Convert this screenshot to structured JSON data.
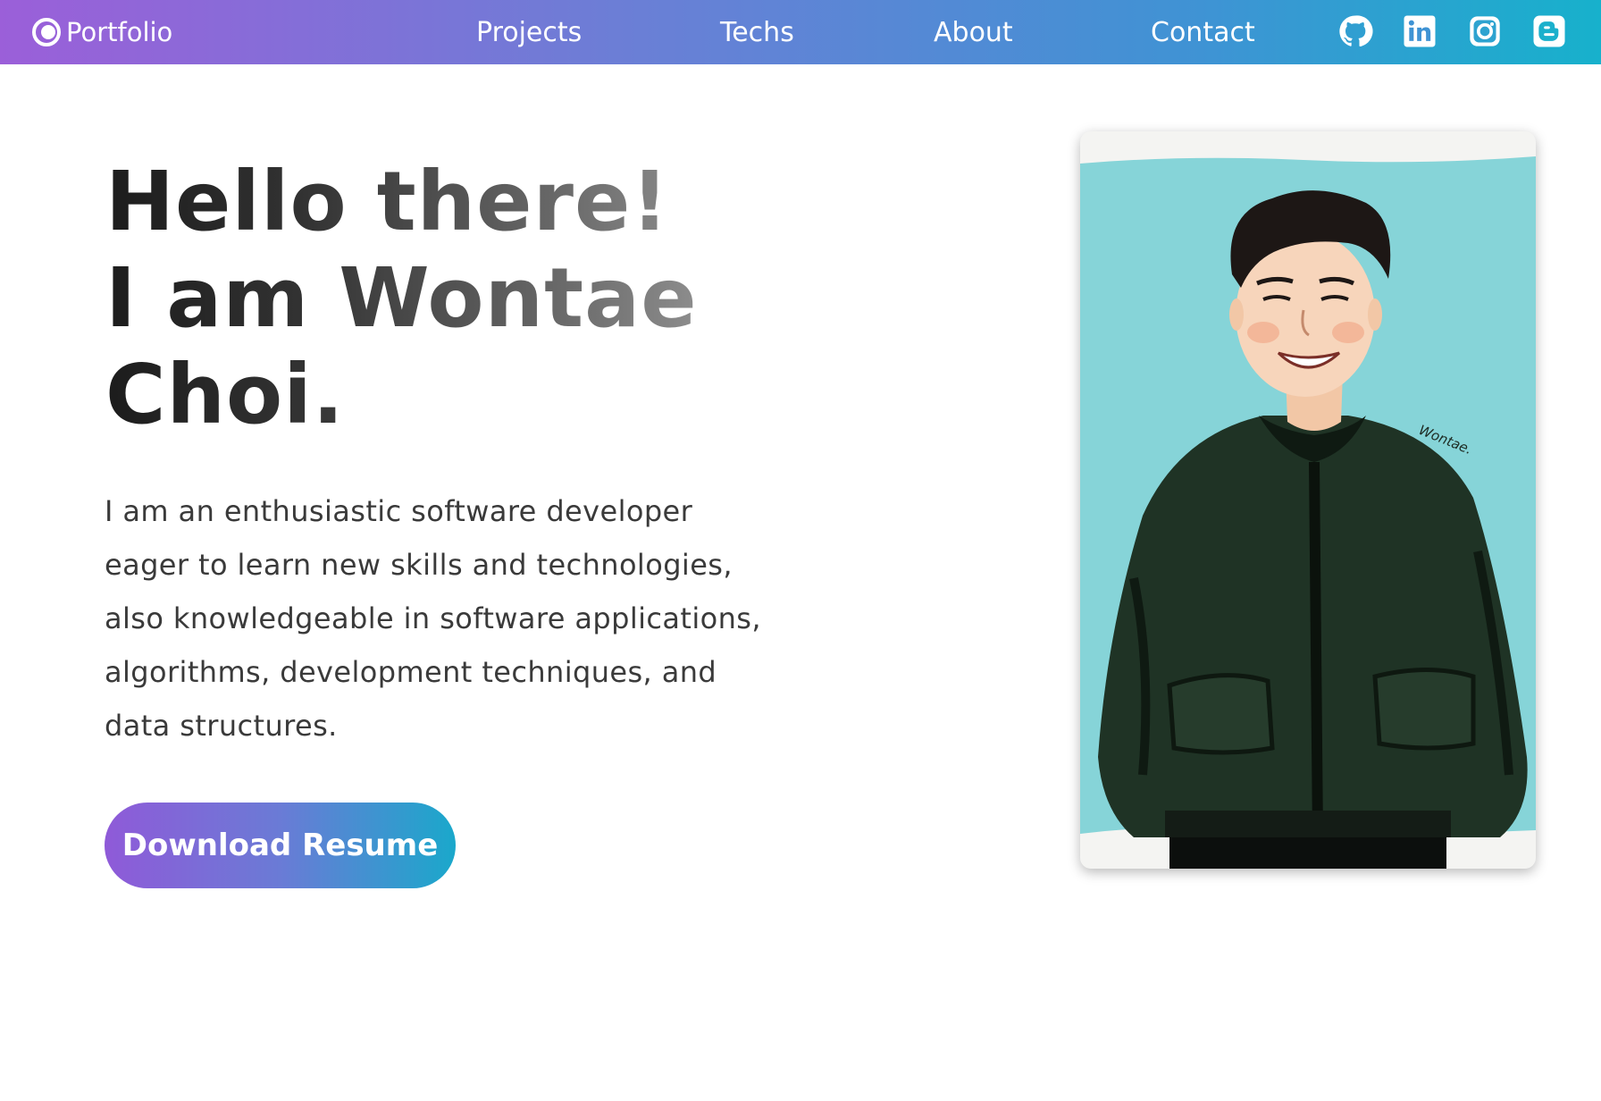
{
  "navbar": {
    "brand": "Portfolio",
    "links": [
      {
        "label": "Projects"
      },
      {
        "label": "Techs"
      },
      {
        "label": "About"
      },
      {
        "label": "Contact"
      }
    ],
    "social_icons": [
      "github-icon",
      "linkedin-icon",
      "instagram-icon",
      "blogger-icon"
    ]
  },
  "hero": {
    "title_lines": [
      "Hello there!",
      "I am Wontae",
      "Choi."
    ],
    "description": "I am an enthusiastic software developer eager to learn new skills and technologies, also knowledgeable in software applications, algorithms, development techniques, and data structures.",
    "resume_button": "Download Resume"
  },
  "portrait": {
    "signature": "Wontae."
  },
  "colors": {
    "gradient_start": "#9b5fd9",
    "gradient_end": "#17b1cc",
    "text_dark": "#1c1c1c",
    "portrait_bg": "#86d4d8"
  }
}
